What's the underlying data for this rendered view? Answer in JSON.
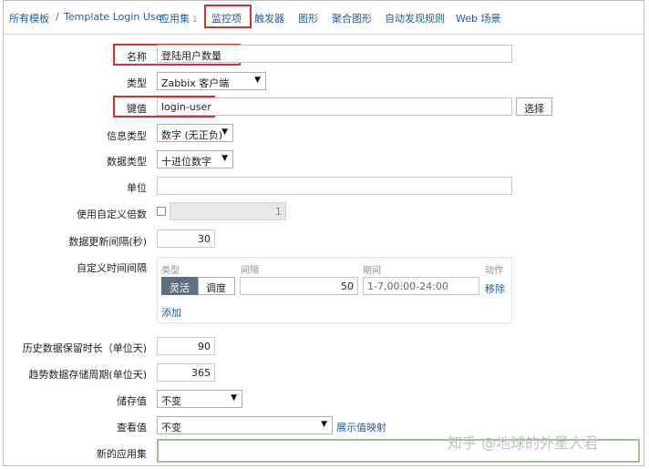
{
  "breadcrumb": {
    "all_templates": "所有模板",
    "separator": "/",
    "template": "Template Login User"
  },
  "tabs": [
    {
      "label": "应用集",
      "count": "1"
    },
    {
      "label": "监控项"
    },
    {
      "label": "触发器"
    },
    {
      "label": "图形"
    },
    {
      "label": "聚合图形"
    },
    {
      "label": "自动发现规则"
    },
    {
      "label": "Web 场景"
    }
  ],
  "form": {
    "name": {
      "label": "名称",
      "value": "登陆用户数量"
    },
    "type": {
      "label": "类型",
      "value": "Zabbix 客户端"
    },
    "key": {
      "label": "键值",
      "value": "login-user",
      "select_button": "选择"
    },
    "info_type": {
      "label": "信息类型",
      "value": "数字 (无正负)"
    },
    "data_type": {
      "label": "数据类型",
      "value": "十进位数字"
    },
    "units": {
      "label": "单位",
      "value": ""
    },
    "multiplier": {
      "label": "使用自定义倍数",
      "checked": false,
      "value": "1"
    },
    "update_interval": {
      "label": "数据更新间隔(秒)",
      "value": "30"
    },
    "custom_intervals": {
      "label": "自定义时间间隔",
      "col_type": "类型",
      "col_interval": "间隔",
      "col_period": "期间",
      "col_action": "动作",
      "row": {
        "flexible": "灵活",
        "scheduling": "调度",
        "interval": "50",
        "period": "1-7,00:00-24:00",
        "remove": "移除"
      },
      "add": "添加"
    },
    "history": {
      "label": "历史数据保留时长（单位天)",
      "value": "90"
    },
    "trends": {
      "label": "趋势数据存储周期(单位天)",
      "value": "365"
    },
    "store_value": {
      "label": "储存值",
      "value": "不变"
    },
    "show_value": {
      "label": "查看值",
      "value": "不变",
      "link": "展示值映射"
    },
    "new_application": {
      "label": "新的应用集",
      "value": ""
    }
  },
  "watermark": "知乎 @地球的外星人君",
  "colors": {
    "link": "#1f5c9c",
    "highlight": "#d62f2f",
    "active_segment": "#5f6f80"
  }
}
